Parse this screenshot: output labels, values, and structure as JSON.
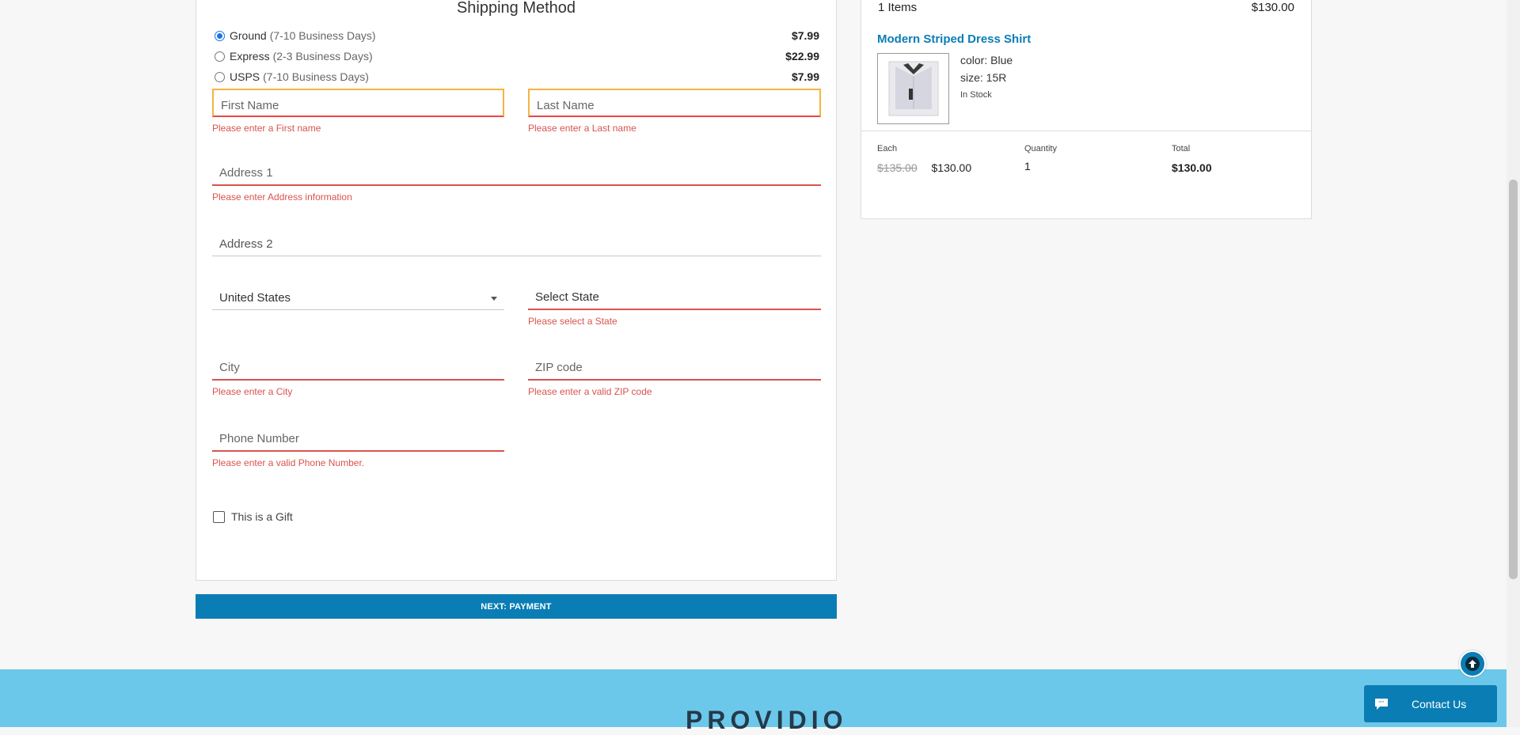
{
  "shipping": {
    "title": "Shipping Method",
    "methods": [
      {
        "name": "Ground",
        "days": "(7-10 Business Days)",
        "price": "$7.99",
        "selected": true
      },
      {
        "name": "Express",
        "days": "(2-3 Business Days)",
        "price": "$22.99",
        "selected": false
      },
      {
        "name": "USPS",
        "days": "(7-10 Business Days)",
        "price": "$7.99",
        "selected": false
      }
    ]
  },
  "form": {
    "first_name": {
      "placeholder": "First Name",
      "error": "Please enter a First name"
    },
    "last_name": {
      "placeholder": "Last Name",
      "error": "Please enter a Last name"
    },
    "address1": {
      "placeholder": "Address 1",
      "error": "Please enter Address information"
    },
    "address2": {
      "placeholder": "Address 2"
    },
    "country": {
      "value": "United States"
    },
    "state": {
      "placeholder": "Select State",
      "error": "Please select a State"
    },
    "city": {
      "placeholder": "City",
      "error": "Please enter a City"
    },
    "zip": {
      "placeholder": "ZIP code",
      "error": "Please enter a valid ZIP code"
    },
    "phone": {
      "placeholder": "Phone Number",
      "error": "Please enter a valid Phone Number."
    },
    "gift_label": "This is a Gift",
    "next_label": "NEXT: PAYMENT"
  },
  "cart": {
    "items_count": "1 Items",
    "items_total": "$130.00",
    "product": {
      "name": "Modern Striped Dress Shirt",
      "color": "color: Blue",
      "size": "size: 15R",
      "stock": "In Stock",
      "thumbnail_icon": "shirt-icon"
    },
    "each_label": "Each",
    "original_price": "$135.00",
    "price": "$130.00",
    "quantity_label": "Quantity",
    "quantity": "1",
    "total_label": "Total",
    "total": "$130.00"
  },
  "footer": {
    "brand": "PROVIDIO",
    "contact_label": "Contact Us"
  },
  "colors": {
    "accent": "#0a7db5",
    "error": "#d9534f",
    "footer_band": "#6bc8ea"
  }
}
